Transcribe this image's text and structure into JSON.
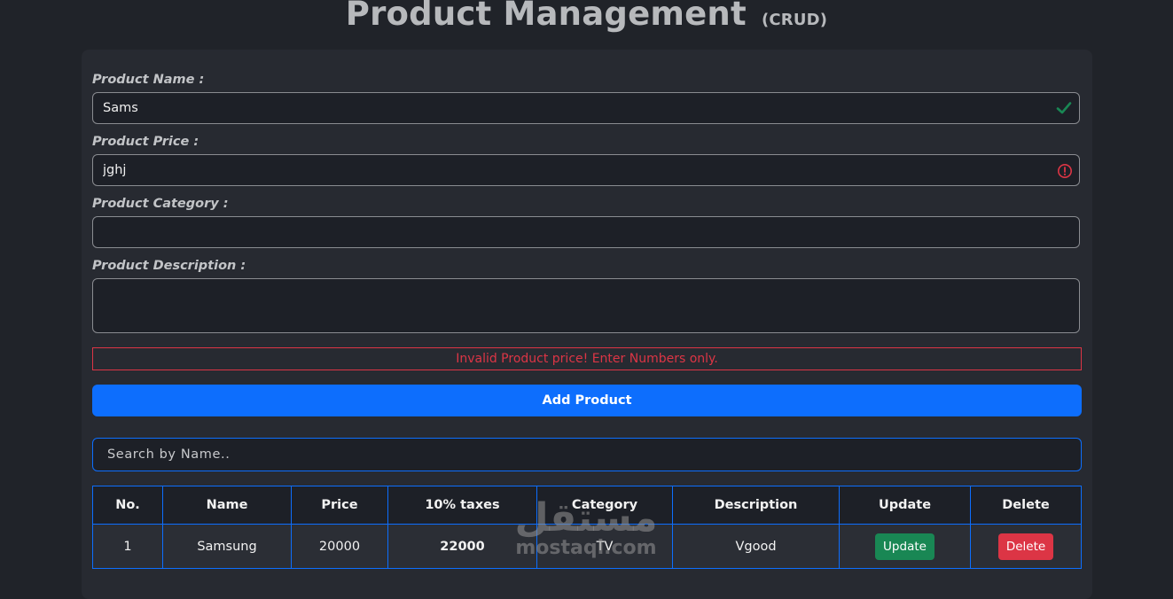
{
  "header": {
    "title": "Product Management",
    "subtitle": "(CRUD)"
  },
  "form": {
    "name_label": "Product Name :",
    "name_value": "Sams",
    "price_label": "Product Price :",
    "price_value": "jghj",
    "category_label": "Product Category :",
    "category_value": "",
    "description_label": "Product Description :",
    "description_value": "",
    "error_message": "Invalid Product price! Enter Numbers only.",
    "add_button": "Add Product"
  },
  "search": {
    "placeholder": "Search by Name.."
  },
  "table": {
    "headers": [
      "No.",
      "Name",
      "Price",
      "10% taxes",
      "Category",
      "Description",
      "Update",
      "Delete"
    ],
    "rows": [
      {
        "no": "1",
        "name": "Samsung",
        "price": "20000",
        "taxes": "22000",
        "category": "TV",
        "description": "Vgood",
        "update_label": "Update",
        "delete_label": "Delete"
      }
    ]
  },
  "watermark": {
    "arabic": "مستقل",
    "latin": "mostaql.com"
  },
  "colors": {
    "background": "#202329",
    "card": "#272a31",
    "primary": "#0d6efd",
    "success": "#198754",
    "danger": "#dc3545"
  },
  "icons": {
    "name_status": "check-icon",
    "price_status": "exclamation-circle-icon"
  }
}
